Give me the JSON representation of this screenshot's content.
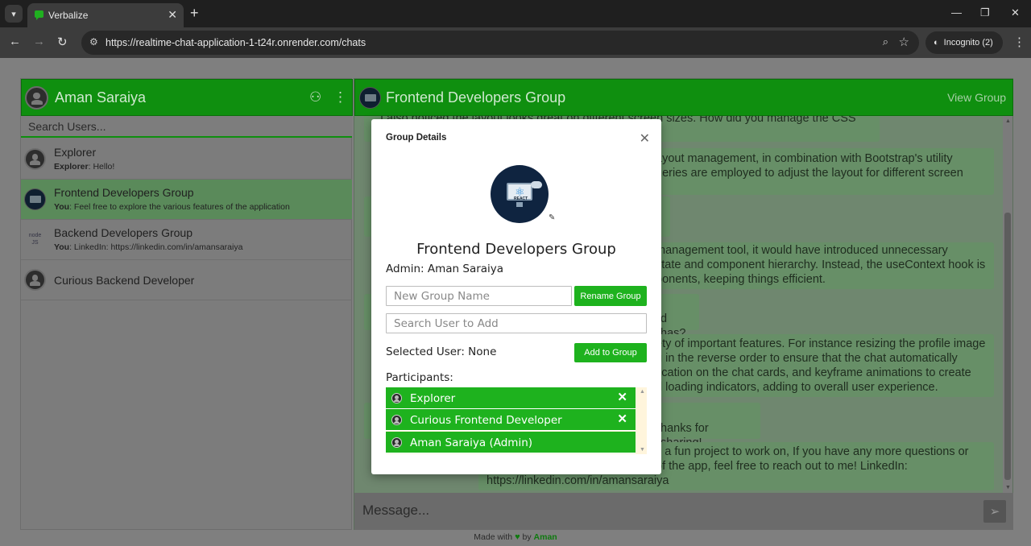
{
  "browser": {
    "tab_title": "Verbalize",
    "url": "https://realtime-chat-application-1-t24r.onrender.com/chats",
    "incognito_label": "Incognito (2)"
  },
  "sidebar": {
    "user_name": "Aman Saraiya",
    "search_placeholder": "Search Users...",
    "chats": [
      {
        "name": "Explorer",
        "sender": "Explorer",
        "message": "Hello!"
      },
      {
        "name": "Frontend Developers Group",
        "sender": "You",
        "message": "Feel free to explore the various features of the application"
      },
      {
        "name": "Backend Developers Group",
        "sender": "You",
        "message": "LinkedIn: https://linkedin.com/in/amansaraiya"
      },
      {
        "name": "Curious Backend Developer",
        "sender": "",
        "message": ""
      }
    ]
  },
  "chat": {
    "title": "Frontend Developers Group",
    "view_group": "View Group",
    "message_placeholder": "Message...",
    "bubbles": [
      {
        "lines": [
          "I also noticed the layout looks great on different screen sizes. How did you manage the CSS and"
        ]
      },
      {
        "lines": [
          "ayout management, in combination with Bootstrap's utility",
          "ueries are employed to adjust the layout for different screen"
        ]
      },
      {
        "lines": [
          "management tool, it would have introduced unnecessary",
          "state and component hierarchy. Instead, the useContext hook is",
          "ponents, keeping things efficient."
        ]
      },
      {
        "lines": [
          "d has?"
        ]
      },
      {
        "lines": [
          "ety of important features. For instance resizing the profile image",
          "g in the reverse order to ensure that the chat automatically",
          "fication on the chat cards, and keyframe animations to create",
          "d loading indicators, adding to overall user experience."
        ]
      },
      {
        "lines": [
          "hanks for sharing!"
        ]
      },
      {
        "lines": [
          "s a fun project to work on, If you have any more questions or",
          "of the app, feel free to reach out to me! LinkedIn:",
          "https://linkedin.com/in/amansaraiya"
        ]
      }
    ]
  },
  "footer": {
    "made_with": "Made with",
    "by": "by",
    "author": "Aman"
  },
  "modal": {
    "title": "Group Details",
    "group_name": "Frontend Developers Group",
    "image_label": "REACT",
    "admin_text": "Admin: Aman Saraiya",
    "rename_placeholder": "New Group Name",
    "rename_button": "Rename Group",
    "search_placeholder": "Search User to Add",
    "selected_user_text": "Selected User: None",
    "add_button": "Add to Group",
    "participants_label": "Participants:",
    "participants": [
      {
        "name": "Explorer",
        "removable": true
      },
      {
        "name": "Curious Frontend Developer",
        "removable": true
      },
      {
        "name": "Aman Saraiya (Admin)",
        "removable": false
      }
    ]
  },
  "colors": {
    "brand_green": "#1eb21e",
    "header_green": "#0f8f0f",
    "overlay": "rgba(0,0,0,0.5)"
  },
  "icons": {
    "new_group": "add-user-icon",
    "menu": "kebab-icon",
    "send": "send-icon",
    "close": "close-icon",
    "edit": "pencil-icon",
    "remove": "remove-icon"
  }
}
